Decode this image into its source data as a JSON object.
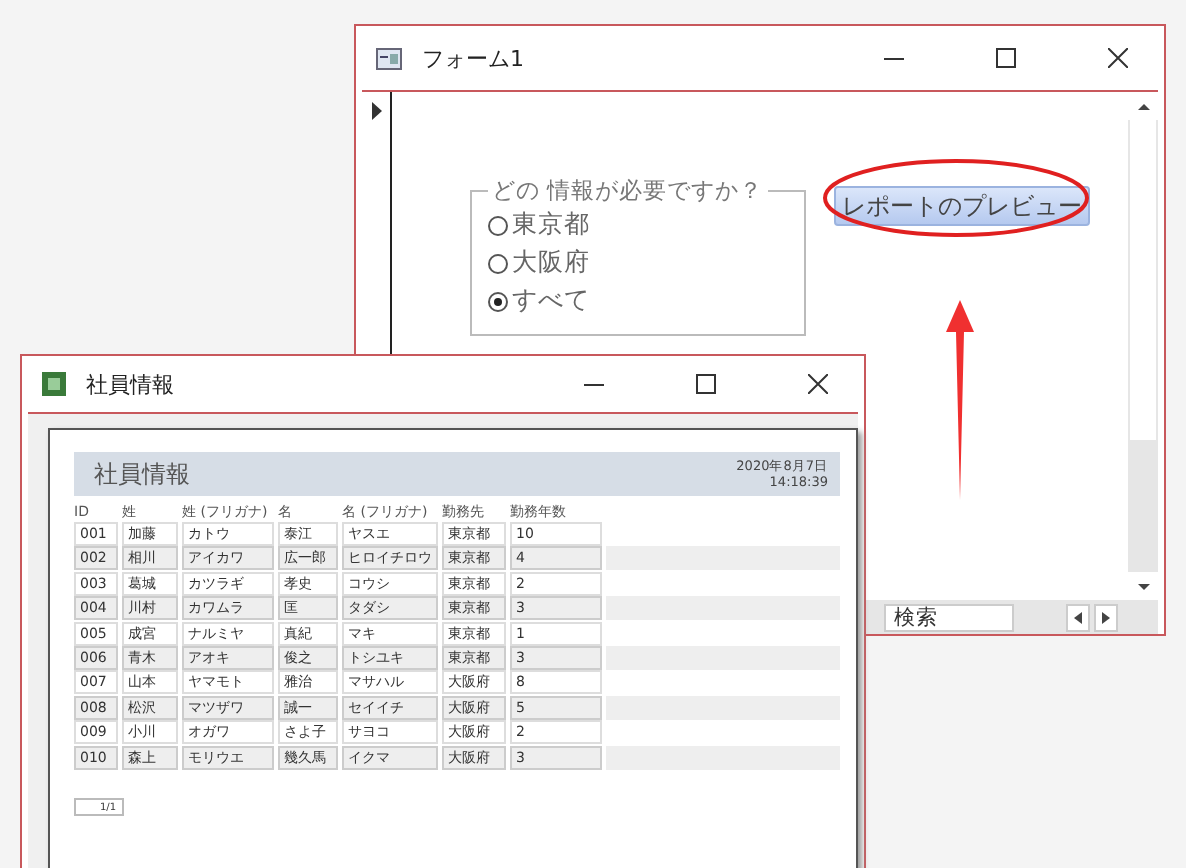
{
  "form_window": {
    "title": "フォーム1",
    "option_group": {
      "label": "どの 情報が必要ですか？",
      "options": [
        {
          "label": "東京都",
          "selected": false
        },
        {
          "label": "大阪府",
          "selected": false
        },
        {
          "label": "すべて",
          "selected": true
        }
      ]
    },
    "button": "レポートのプレビュー",
    "search": {
      "placeholder": "検索"
    }
  },
  "report_window": {
    "title": "社員情報",
    "report": {
      "title": "社員情報",
      "date": "2020年8月7日",
      "time": "14:18:39",
      "columns": [
        "ID",
        "姓",
        "姓 (フリガナ)",
        "名",
        "名 (フリガナ)",
        "勤務先",
        "勤務年数"
      ],
      "rows": [
        [
          "001",
          "加藤",
          "カトウ",
          "泰江",
          "ヤスエ",
          "東京都",
          "10"
        ],
        [
          "002",
          "相川",
          "アイカワ",
          "広一郎",
          "ヒロイチロウ",
          "東京都",
          "4"
        ],
        [
          "003",
          "葛城",
          "カツラギ",
          "孝史",
          "コウシ",
          "東京都",
          "2"
        ],
        [
          "004",
          "川村",
          "カワムラ",
          "匡",
          "タダシ",
          "東京都",
          "3"
        ],
        [
          "005",
          "成宮",
          "ナルミヤ",
          "真紀",
          "マキ",
          "東京都",
          "1"
        ],
        [
          "006",
          "青木",
          "アオキ",
          "俊之",
          "トシユキ",
          "東京都",
          "3"
        ],
        [
          "007",
          "山本",
          "ヤマモト",
          "雅治",
          "マサハル",
          "大阪府",
          "8"
        ],
        [
          "008",
          "松沢",
          "マツザワ",
          "誠一",
          "セイイチ",
          "大阪府",
          "5"
        ],
        [
          "009",
          "小川",
          "オガワ",
          "さよ子",
          "サヨコ",
          "大阪府",
          "2"
        ],
        [
          "010",
          "森上",
          "モリウエ",
          "幾久馬",
          "イクマ",
          "大阪府",
          "3"
        ]
      ],
      "page": "1/1"
    }
  }
}
